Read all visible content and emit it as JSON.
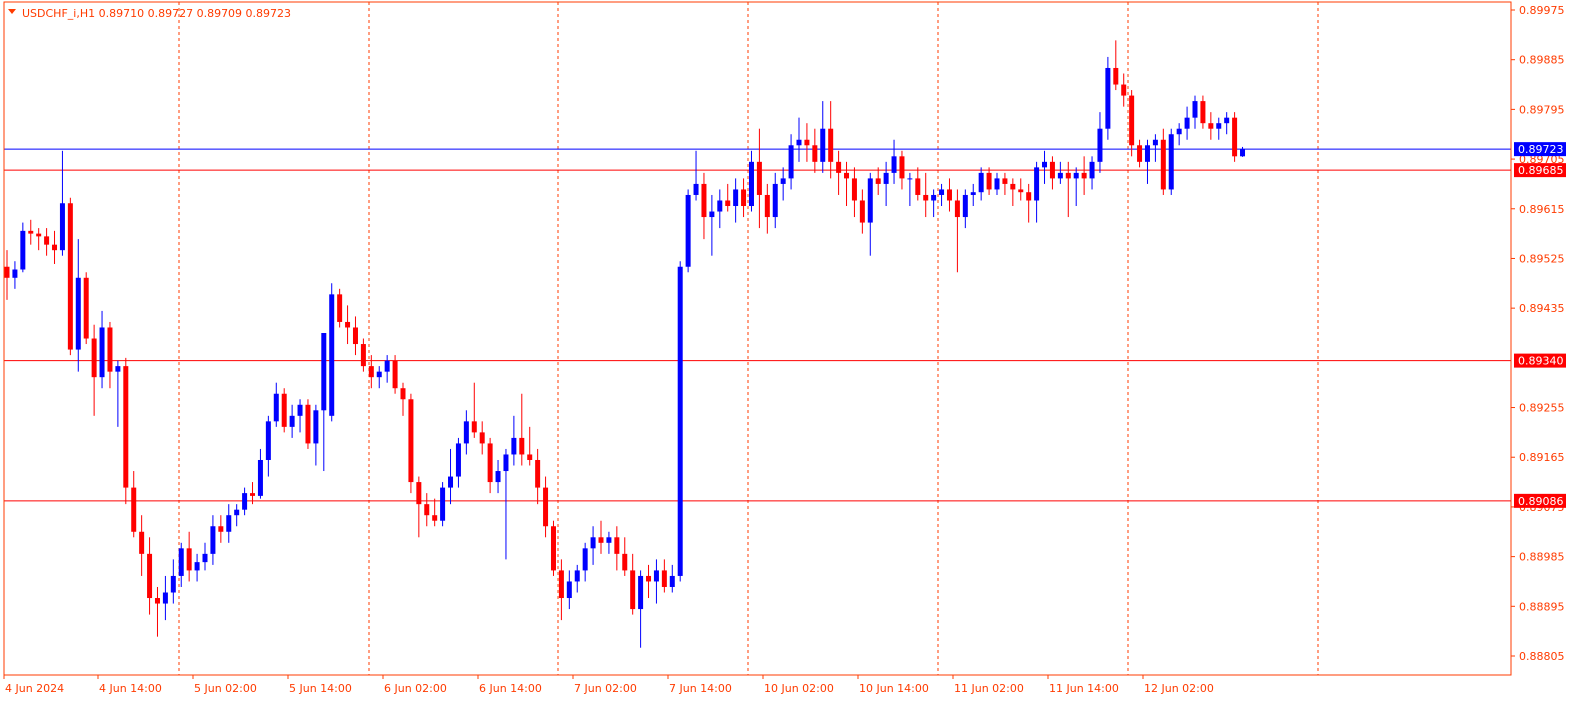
{
  "window": {
    "title": "USDCHF_i,H1  0.89710 0.89727 0.89709 0.89723"
  },
  "colors": {
    "bull": "#0000ff",
    "bear": "#ff0000",
    "axis": "#ff3b00",
    "grid": "#ff3b00",
    "hline_red": "#ff0000",
    "hline_blue": "#0000ff",
    "tag_red": "#ff0000",
    "tag_blue": "#0000ff"
  },
  "chart_data": {
    "type": "candlestick",
    "symbol": "USDCHF_i",
    "timeframe": "H1",
    "last_ohlc": {
      "open": 0.8971,
      "high": 0.89727,
      "low": 0.89709,
      "close": 0.89723
    },
    "y_ticks": [
      "0.89975",
      "0.89885",
      "0.89795",
      "0.89705",
      "0.89615",
      "0.89525",
      "0.89435",
      "0.89255",
      "0.89165",
      "0.89075",
      "0.88985",
      "0.88895",
      "0.88805"
    ],
    "ylim": [
      0.8877,
      0.89985
    ],
    "x_ticks": [
      "4 Jun 2024",
      "4 Jun 14:00",
      "5 Jun 02:00",
      "5 Jun 14:00",
      "6 Jun 02:00",
      "6 Jun 14:00",
      "7 Jun 02:00",
      "7 Jun 14:00",
      "10 Jun 02:00",
      "10 Jun 14:00",
      "11 Jun 02:00",
      "11 Jun 14:00",
      "12 Jun 02:00"
    ],
    "bars_per_tick": 12,
    "grid": "vertical-dotted",
    "levels": [
      {
        "label": "0.89723",
        "value": 0.89723,
        "color": "blue"
      },
      {
        "label": "0.89685",
        "value": 0.89685,
        "color": "red"
      },
      {
        "label": "0.89340",
        "value": 0.8934,
        "color": "red"
      },
      {
        "label": "0.89086",
        "value": 0.89086,
        "color": "red"
      }
    ],
    "ohlc": [
      [
        0.8951,
        0.8954,
        0.8945,
        0.8949
      ],
      [
        0.8949,
        0.8952,
        0.8947,
        0.89505
      ],
      [
        0.89505,
        0.8959,
        0.895,
        0.89575
      ],
      [
        0.89575,
        0.89595,
        0.8955,
        0.8957
      ],
      [
        0.8957,
        0.8958,
        0.8954,
        0.89565
      ],
      [
        0.89565,
        0.8958,
        0.8953,
        0.8955
      ],
      [
        0.8955,
        0.89575,
        0.89515,
        0.8954
      ],
      [
        0.8954,
        0.8972,
        0.8953,
        0.89625
      ],
      [
        0.89625,
        0.89635,
        0.8935,
        0.8936
      ],
      [
        0.8936,
        0.8956,
        0.8932,
        0.8949
      ],
      [
        0.8949,
        0.895,
        0.8937,
        0.8938
      ],
      [
        0.8938,
        0.89405,
        0.8924,
        0.8931
      ],
      [
        0.8931,
        0.8943,
        0.8929,
        0.894
      ],
      [
        0.894,
        0.8941,
        0.8929,
        0.8932
      ],
      [
        0.8932,
        0.8934,
        0.8922,
        0.8933
      ],
      [
        0.8933,
        0.89345,
        0.8908,
        0.8911
      ],
      [
        0.8911,
        0.8914,
        0.8902,
        0.8903
      ],
      [
        0.8903,
        0.8906,
        0.8895,
        0.8899
      ],
      [
        0.8899,
        0.8902,
        0.8888,
        0.8891
      ],
      [
        0.8891,
        0.8893,
        0.8884,
        0.889
      ],
      [
        0.889,
        0.8895,
        0.8887,
        0.8892
      ],
      [
        0.8892,
        0.8898,
        0.889,
        0.8895
      ],
      [
        0.8895,
        0.8901,
        0.8893,
        0.89
      ],
      [
        0.89,
        0.8903,
        0.8894,
        0.8896
      ],
      [
        0.8896,
        0.8899,
        0.8894,
        0.88975
      ],
      [
        0.88975,
        0.8901,
        0.8896,
        0.8899
      ],
      [
        0.8899,
        0.8906,
        0.8897,
        0.8904
      ],
      [
        0.8904,
        0.8906,
        0.8901,
        0.8903
      ],
      [
        0.8903,
        0.8908,
        0.8901,
        0.8906
      ],
      [
        0.8906,
        0.8908,
        0.8904,
        0.8907
      ],
      [
        0.8907,
        0.8911,
        0.8906,
        0.891
      ],
      [
        0.891,
        0.8912,
        0.8908,
        0.89095
      ],
      [
        0.89095,
        0.8918,
        0.8909,
        0.8916
      ],
      [
        0.8916,
        0.8924,
        0.8913,
        0.8923
      ],
      [
        0.8923,
        0.893,
        0.8922,
        0.8928
      ],
      [
        0.8928,
        0.8929,
        0.8921,
        0.8922
      ],
      [
        0.8922,
        0.8926,
        0.892,
        0.8924
      ],
      [
        0.8924,
        0.8927,
        0.8921,
        0.8926
      ],
      [
        0.8926,
        0.8927,
        0.8918,
        0.8919
      ],
      [
        0.8919,
        0.8926,
        0.8915,
        0.8925
      ],
      [
        0.8925,
        0.8932,
        0.8914,
        0.8939
      ],
      [
        0.8924,
        0.8948,
        0.8923,
        0.8946
      ],
      [
        0.8946,
        0.8947,
        0.894,
        0.8941
      ],
      [
        0.8941,
        0.8944,
        0.8937,
        0.894
      ],
      [
        0.894,
        0.8942,
        0.8935,
        0.8937
      ],
      [
        0.8937,
        0.8938,
        0.8932,
        0.8933
      ],
      [
        0.8933,
        0.8935,
        0.8929,
        0.8931
      ],
      [
        0.8931,
        0.8933,
        0.8929,
        0.8932
      ],
      [
        0.8932,
        0.8935,
        0.893,
        0.8934
      ],
      [
        0.8934,
        0.8935,
        0.8928,
        0.8929
      ],
      [
        0.8929,
        0.893,
        0.8924,
        0.8927
      ],
      [
        0.8927,
        0.8928,
        0.891,
        0.8912
      ],
      [
        0.8912,
        0.8913,
        0.8902,
        0.8908
      ],
      [
        0.8908,
        0.891,
        0.8904,
        0.8906
      ],
      [
        0.8906,
        0.8909,
        0.8904,
        0.8905
      ],
      [
        0.8905,
        0.8912,
        0.8904,
        0.8911
      ],
      [
        0.8911,
        0.8918,
        0.8908,
        0.8913
      ],
      [
        0.8913,
        0.892,
        0.8911,
        0.8919
      ],
      [
        0.8919,
        0.8925,
        0.8917,
        0.8923
      ],
      [
        0.8923,
        0.893,
        0.892,
        0.8921
      ],
      [
        0.8921,
        0.8923,
        0.8917,
        0.8919
      ],
      [
        0.8919,
        0.892,
        0.891,
        0.8912
      ],
      [
        0.8912,
        0.8916,
        0.891,
        0.8914
      ],
      [
        0.8914,
        0.8918,
        0.8898,
        0.8917
      ],
      [
        0.8917,
        0.8924,
        0.8915,
        0.892
      ],
      [
        0.892,
        0.8928,
        0.8915,
        0.8917
      ],
      [
        0.8917,
        0.8922,
        0.8915,
        0.8916
      ],
      [
        0.8916,
        0.8918,
        0.8908,
        0.8911
      ],
      [
        0.8911,
        0.8913,
        0.8902,
        0.8904
      ],
      [
        0.8904,
        0.8905,
        0.8895,
        0.8896
      ],
      [
        0.8896,
        0.8898,
        0.8887,
        0.8891
      ],
      [
        0.8891,
        0.8896,
        0.8889,
        0.8894
      ],
      [
        0.8894,
        0.8897,
        0.8892,
        0.8896
      ],
      [
        0.8896,
        0.8901,
        0.8894,
        0.89
      ],
      [
        0.89,
        0.8904,
        0.8897,
        0.8902
      ],
      [
        0.8902,
        0.8905,
        0.8899,
        0.8901
      ],
      [
        0.8901,
        0.8903,
        0.8899,
        0.8902
      ],
      [
        0.8902,
        0.8904,
        0.8896,
        0.8899
      ],
      [
        0.8899,
        0.8902,
        0.8895,
        0.8896
      ],
      [
        0.8896,
        0.8899,
        0.8888,
        0.8889
      ],
      [
        0.8889,
        0.8896,
        0.8882,
        0.8895
      ],
      [
        0.8895,
        0.8897,
        0.8891,
        0.8894
      ],
      [
        0.8894,
        0.8898,
        0.889,
        0.8896
      ],
      [
        0.8896,
        0.8898,
        0.8892,
        0.8893
      ],
      [
        0.8893,
        0.8897,
        0.8892,
        0.8895
      ],
      [
        0.8895,
        0.8952,
        0.8894,
        0.8951
      ],
      [
        0.8951,
        0.8965,
        0.895,
        0.8964
      ],
      [
        0.8964,
        0.8972,
        0.8963,
        0.8966
      ],
      [
        0.8966,
        0.8968,
        0.8956,
        0.896
      ],
      [
        0.896,
        0.8964,
        0.8953,
        0.8961
      ],
      [
        0.8961,
        0.8965,
        0.8958,
        0.8963
      ],
      [
        0.8963,
        0.8966,
        0.8961,
        0.8962
      ],
      [
        0.8962,
        0.8967,
        0.8959,
        0.8965
      ],
      [
        0.8965,
        0.8967,
        0.896,
        0.8962
      ],
      [
        0.8962,
        0.8972,
        0.8961,
        0.897
      ],
      [
        0.897,
        0.8976,
        0.8958,
        0.8964
      ],
      [
        0.8964,
        0.8966,
        0.8957,
        0.896
      ],
      [
        0.896,
        0.8968,
        0.8958,
        0.8966
      ],
      [
        0.8966,
        0.8969,
        0.8963,
        0.8967
      ],
      [
        0.8967,
        0.8975,
        0.8965,
        0.8973
      ],
      [
        0.8973,
        0.8978,
        0.897,
        0.8974
      ],
      [
        0.8974,
        0.8977,
        0.897,
        0.8973
      ],
      [
        0.8973,
        0.8976,
        0.8968,
        0.897
      ],
      [
        0.897,
        0.8981,
        0.8968,
        0.8976
      ],
      [
        0.8976,
        0.8981,
        0.8967,
        0.897
      ],
      [
        0.897,
        0.8972,
        0.8964,
        0.8968
      ],
      [
        0.8968,
        0.897,
        0.8962,
        0.8967
      ],
      [
        0.8967,
        0.8969,
        0.896,
        0.8963
      ],
      [
        0.8963,
        0.8965,
        0.8957,
        0.8959
      ],
      [
        0.8959,
        0.8968,
        0.8953,
        0.8967
      ],
      [
        0.8967,
        0.8969,
        0.8964,
        0.8966
      ],
      [
        0.8966,
        0.897,
        0.8962,
        0.8968
      ],
      [
        0.8968,
        0.8974,
        0.8966,
        0.8971
      ],
      [
        0.8971,
        0.8972,
        0.8965,
        0.8967
      ],
      [
        0.8967,
        0.8968,
        0.8962,
        0.8967
      ],
      [
        0.8967,
        0.8969,
        0.8963,
        0.8964
      ],
      [
        0.8964,
        0.8968,
        0.896,
        0.8963
      ],
      [
        0.8963,
        0.8965,
        0.896,
        0.8964
      ],
      [
        0.8964,
        0.8966,
        0.8962,
        0.8965
      ],
      [
        0.8965,
        0.8967,
        0.8961,
        0.8963
      ],
      [
        0.8963,
        0.8965,
        0.895,
        0.896
      ],
      [
        0.896,
        0.8965,
        0.8958,
        0.8964
      ],
      [
        0.8964,
        0.8966,
        0.8962,
        0.89645
      ],
      [
        0.89645,
        0.8969,
        0.8963,
        0.8968
      ],
      [
        0.8968,
        0.8969,
        0.8964,
        0.8965
      ],
      [
        0.8965,
        0.8968,
        0.8964,
        0.8967
      ],
      [
        0.8967,
        0.8968,
        0.8964,
        0.8966
      ],
      [
        0.8966,
        0.8967,
        0.8962,
        0.8965
      ],
      [
        0.8965,
        0.8967,
        0.8963,
        0.89645
      ],
      [
        0.89645,
        0.8966,
        0.8959,
        0.8963
      ],
      [
        0.8963,
        0.897,
        0.8959,
        0.8969
      ],
      [
        0.8969,
        0.8972,
        0.8966,
        0.897
      ],
      [
        0.897,
        0.8971,
        0.8965,
        0.8967
      ],
      [
        0.8967,
        0.897,
        0.8966,
        0.8968
      ],
      [
        0.8968,
        0.897,
        0.896,
        0.8967
      ],
      [
        0.8967,
        0.8969,
        0.8962,
        0.8968
      ],
      [
        0.8968,
        0.8971,
        0.8964,
        0.8967
      ],
      [
        0.8967,
        0.8971,
        0.8965,
        0.897
      ],
      [
        0.897,
        0.8979,
        0.8968,
        0.8976
      ],
      [
        0.8976,
        0.8989,
        0.8974,
        0.8987
      ],
      [
        0.8987,
        0.8992,
        0.8983,
        0.8984
      ],
      [
        0.8984,
        0.8986,
        0.898,
        0.8982
      ],
      [
        0.8982,
        0.8983,
        0.8971,
        0.8973
      ],
      [
        0.8973,
        0.8974,
        0.8969,
        0.897
      ],
      [
        0.897,
        0.8974,
        0.8966,
        0.8973
      ],
      [
        0.8973,
        0.8975,
        0.897,
        0.8974
      ],
      [
        0.8974,
        0.8976,
        0.8964,
        0.8965
      ],
      [
        0.8965,
        0.8976,
        0.8964,
        0.8975
      ],
      [
        0.8975,
        0.8977,
        0.8973,
        0.8976
      ],
      [
        0.8976,
        0.898,
        0.8974,
        0.8978
      ],
      [
        0.8978,
        0.8982,
        0.8976,
        0.8981
      ],
      [
        0.8981,
        0.8982,
        0.8976,
        0.8977
      ],
      [
        0.8977,
        0.8979,
        0.8974,
        0.8976
      ],
      [
        0.8976,
        0.8978,
        0.8974,
        0.8977
      ],
      [
        0.8977,
        0.8979,
        0.8975,
        0.8978
      ],
      [
        0.8978,
        0.8979,
        0.897,
        0.8971
      ],
      [
        0.8971,
        0.89727,
        0.89709,
        0.89723
      ]
    ]
  }
}
